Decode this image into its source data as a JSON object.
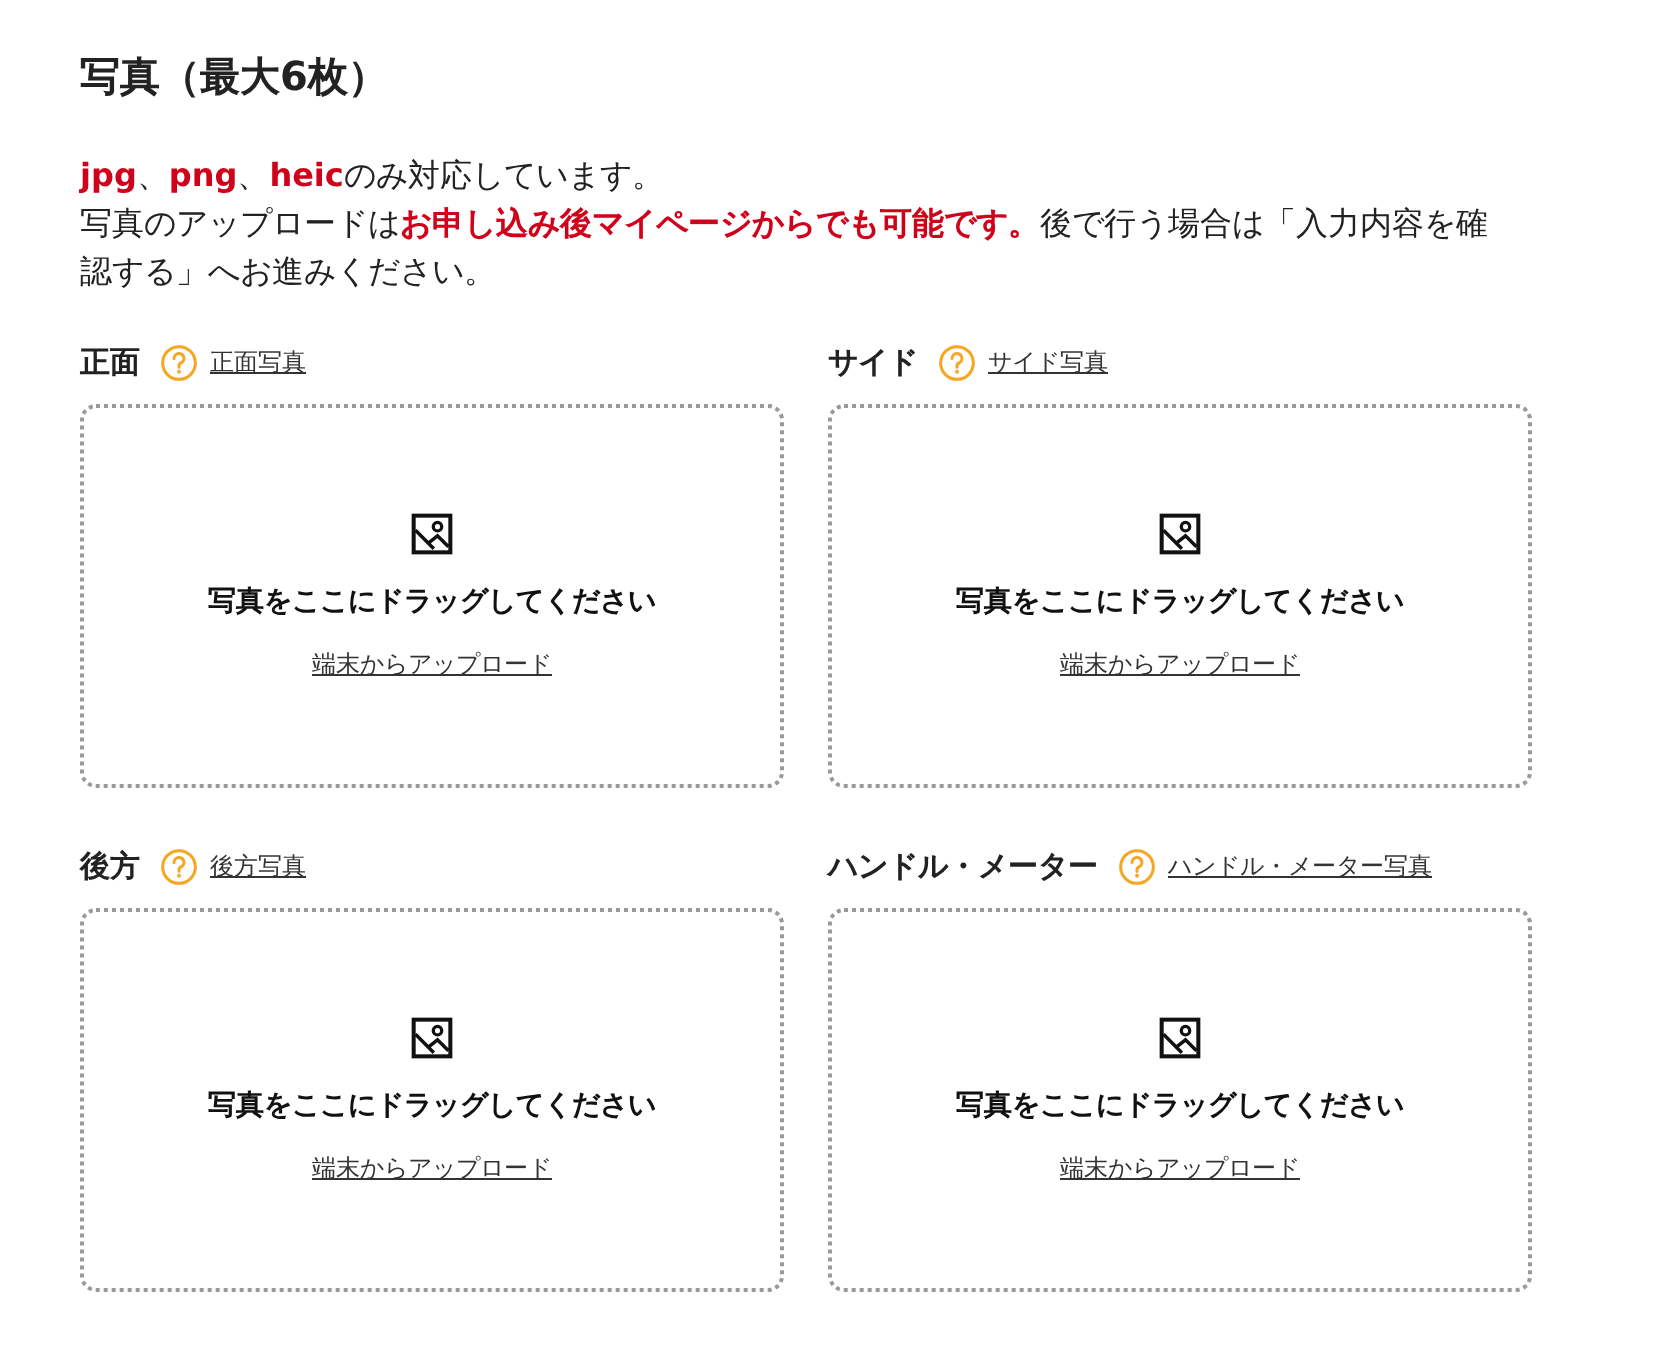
{
  "heading": "写真（最大6枚）",
  "notice": [
    "**jpg**、**png**、**heic**のみ対応しています。",
    "写真のアップロードは**お申し込み後マイページからでも可能です。**後で行う場合は「入力内容を確認する」へお進みください。"
  ],
  "slots": [
    {
      "label": "正面",
      "help_link": "正面写真",
      "drop_text": "写真をここにドラッグしてください",
      "upload_link": "端末からアップロード"
    },
    {
      "label": "サイド",
      "help_link": "サイド写真",
      "drop_text": "写真をここにドラッグしてください",
      "upload_link": "端末からアップロード"
    },
    {
      "label": "後方",
      "help_link": "後方写真",
      "drop_text": "写真をここにドラッグしてください",
      "upload_link": "端末からアップロード"
    },
    {
      "label": "ハンドル・メーター",
      "help_link": "ハンドル・メーター写真",
      "drop_text": "写真をここにドラッグしてください",
      "upload_link": "端末からアップロード"
    }
  ]
}
